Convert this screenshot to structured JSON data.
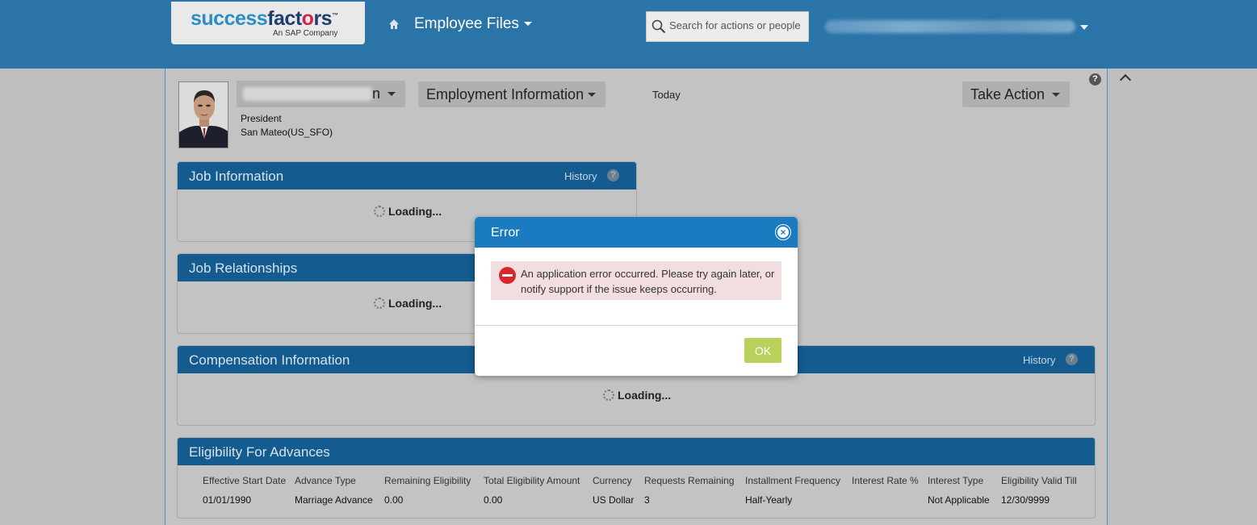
{
  "header": {
    "logo_main_a": "success",
    "logo_main_b": "fact",
    "logo_main_heart": "o",
    "logo_main_c": "rs",
    "logo_sub": "An SAP Company",
    "nav_title": "Employee Files",
    "search_placeholder": "Search for actions or people",
    "icons": [
      "home-icon",
      "search-icon",
      "chevron-down-icon"
    ]
  },
  "profile": {
    "name_visible_suffix": "n",
    "job_title": "President",
    "location": "San Mateo(US_SFO)",
    "view_selector": "Employment Information",
    "date_label": "Today",
    "take_action": "Take Action"
  },
  "panels": {
    "job_information": {
      "title": "Job Information",
      "history": "History",
      "loading": "Loading..."
    },
    "job_relationships": {
      "title": "Job Relationships",
      "loading": "Loading..."
    },
    "compensation": {
      "title": "Compensation Information",
      "history": "History",
      "loading": "Loading..."
    },
    "eligibility": {
      "title": "Eligibility For Advances",
      "columns": [
        "Effective Start Date",
        "Advance Type",
        "Remaining Eligibility",
        "Total Eligibility Amount",
        "Currency",
        "Requests Remaining",
        "Installment Frequency",
        "Interest Rate %",
        "Interest Type",
        "Eligibility Valid Till"
      ],
      "rows": [
        [
          "01/01/1990",
          "Marriage Advance",
          "0.00",
          "0.00",
          "US Dollar",
          "3",
          "Half-Yearly",
          "",
          "Not Applicable",
          "12/30/9999"
        ]
      ]
    }
  },
  "modal": {
    "title": "Error",
    "message": "An application error occurred. Please try again later, or notify support if the issue keeps occurring.",
    "ok": "OK"
  },
  "colors": {
    "header_blue": "#2a74a8",
    "panel_head": "#145b8f",
    "modal_head": "#1a7bc0",
    "error_bg": "#f2dede",
    "error_icon": "#d9272e",
    "ok_button": "#b7d15a"
  }
}
